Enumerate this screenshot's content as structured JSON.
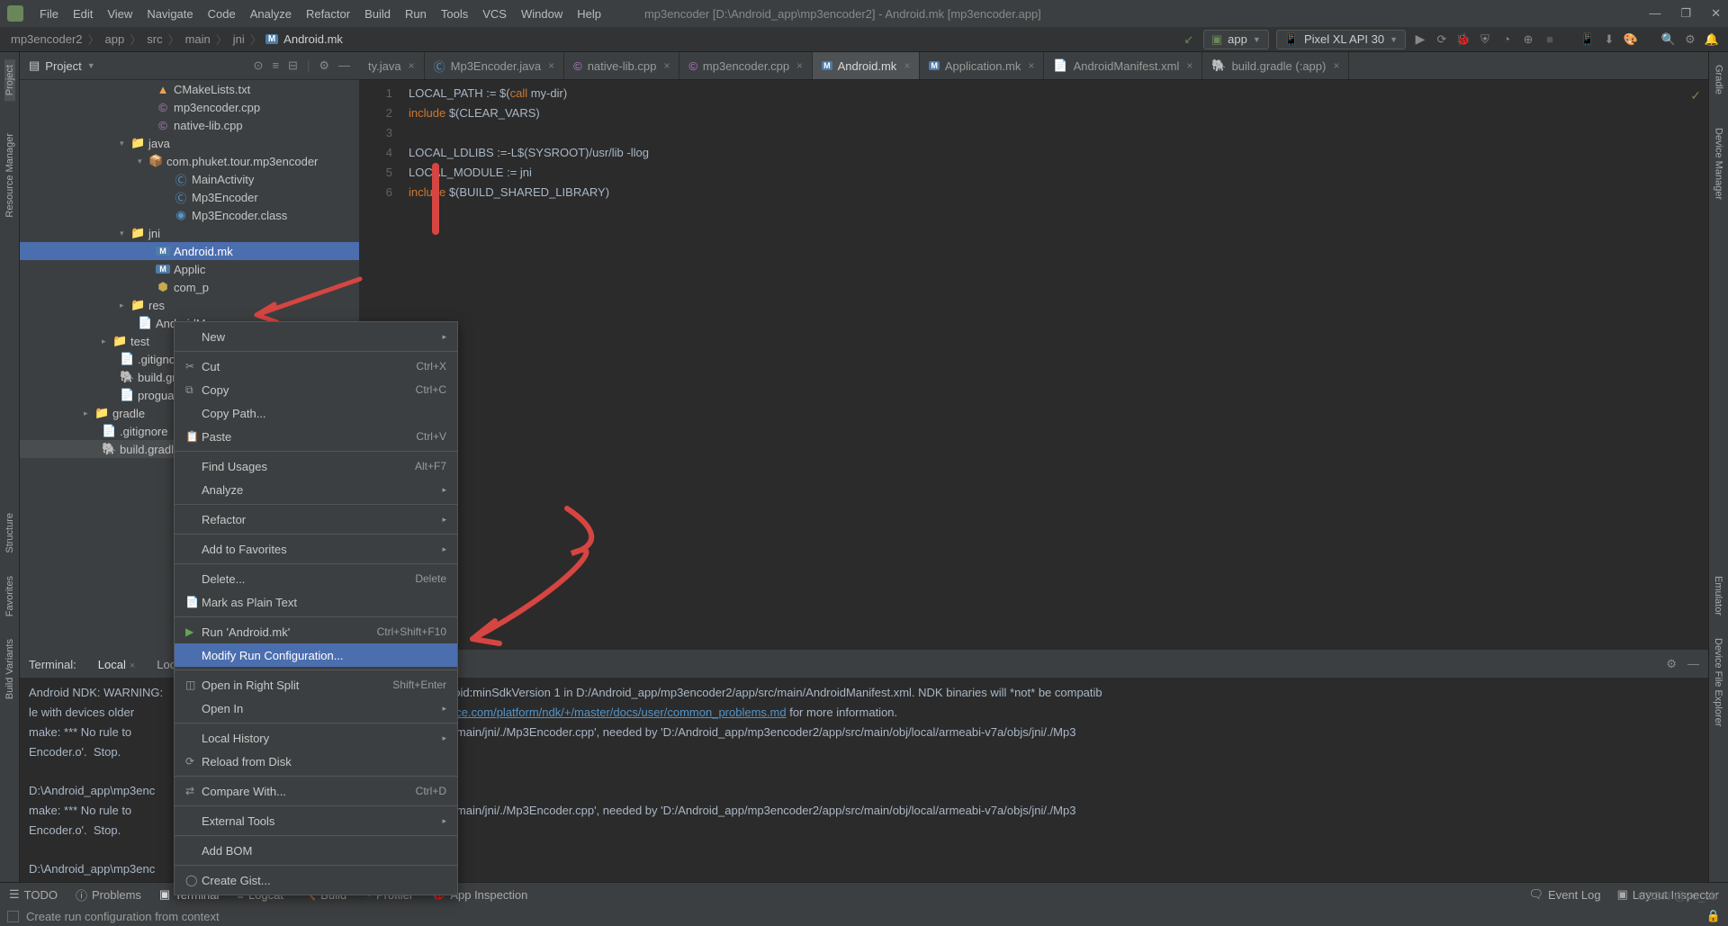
{
  "window": {
    "title": "mp3encoder [D:\\Android_app\\mp3encoder2] - Android.mk [mp3encoder.app]",
    "minimize": "—",
    "maximize": "❐",
    "close": "✕"
  },
  "menu": {
    "file": "File",
    "edit": "Edit",
    "view": "View",
    "navigate": "Navigate",
    "code": "Code",
    "analyze": "Analyze",
    "refactor": "Refactor",
    "build": "Build",
    "run": "Run",
    "tools": "Tools",
    "vcs": "VCS",
    "window": "Window",
    "help": "Help"
  },
  "breadcrumb": {
    "c0": "mp3encoder2",
    "c1": "app",
    "c2": "src",
    "c3": "main",
    "c4": "jni",
    "c5": "Android.mk"
  },
  "toolbar": {
    "config": "app",
    "device": "Pixel XL API 30"
  },
  "leftrail": {
    "project": "Project",
    "resmgr": "Resource Manager",
    "structure": "Structure",
    "favorites": "Favorites",
    "buildvariants": "Build Variants"
  },
  "rightrail": {
    "gradle": "Gradle",
    "devmgr": "Device Manager",
    "emulator": "Emulator",
    "devexp": "Device File Explorer"
  },
  "projpanel": {
    "title": "Project"
  },
  "tree": {
    "cmake": "CMakeLists.txt",
    "mp3cpp": "mp3encoder.cpp",
    "native": "native-lib.cpp",
    "java": "java",
    "pkg": "com.phuket.tour.mp3encoder",
    "mainact": "MainActivity",
    "mp3enc": "Mp3Encoder",
    "mp3cls": "Mp3Encoder.class",
    "jni": "jni",
    "androidmk": "Android.mk",
    "appmk": "Applic",
    "comp": "com_p",
    "res": "res",
    "manifest": "AndroidM",
    "test": "test",
    "gitignore1": ".gitignore",
    "buildgradle1": "build.gradle",
    "proguard": "proguard-rules.",
    "gradle": "gradle",
    "gitignore2": ".gitignore",
    "buildgradle2": "build.gradle"
  },
  "tabs": {
    "t0": "ty.java",
    "t1": "Mp3Encoder.java",
    "t2": "native-lib.cpp",
    "t3": "mp3encoder.cpp",
    "t4": "Android.mk",
    "t5": "Application.mk",
    "t6": "AndroidManifest.xml",
    "t7": "build.gradle (:app)"
  },
  "code": {
    "l1a": "LOCAL_PATH := $(",
    "l1b": "call",
    "l1c": " my-dir)",
    "l2a": "include",
    "l2b": " $(CLEAR_VARS)",
    "l3": "",
    "l4": "LOCAL_LDLIBS :=-L$(SYSROOT)/usr/lib -llog",
    "l5": "LOCAL_MODULE := jni",
    "l6a": "include",
    "l6b": " $(BUILD_SHARED_LIBRARY)",
    "ln1": "1",
    "ln2": "2",
    "ln3": "3",
    "ln4": "4",
    "ln5": "5",
    "ln6": "6"
  },
  "ctx": {
    "new": "New",
    "cut": "Cut",
    "copy": "Copy",
    "copypath": "Copy Path...",
    "paste": "Paste",
    "findusages": "Find Usages",
    "analyze": "Analyze",
    "refactor": "Refactor",
    "addfav": "Add to Favorites",
    "delete": "Delete...",
    "markplain": "Mark as Plain Text",
    "runandroid": "Run 'Android.mk'",
    "modifyrun": "Modify Run Configuration...",
    "opensplit": "Open in Right Split",
    "openin": "Open In",
    "localhist": "Local History",
    "reload": "Reload from Disk",
    "compare": "Compare With...",
    "exttools": "External Tools",
    "addbom": "Add BOM",
    "creategist": "Create Gist...",
    "sc_cut": "Ctrl+X",
    "sc_copy": "Ctrl+C",
    "sc_paste": "Ctrl+V",
    "sc_find": "Alt+F7",
    "sc_delete": "Delete",
    "sc_run": "Ctrl+Shift+F10",
    "sc_split": "Shift+Enter",
    "sc_compare": "Ctrl+D"
  },
  "termpanel": {
    "label": "Terminal:",
    "local": "Local",
    "local2": "Loca"
  },
  "terminal": {
    "l1a": "Android NDK: WARNING:",
    "l1b": "r than android:minSdkVersion 1 in D:/Android_app/mp3encoder2/app/src/main/AndroidManifest.xml. NDK binaries will *not* be compatib",
    "l2a": "le with devices older",
    "l2link": "droid.googlesource.com/platform/ndk/+/master/docs/user/common_problems.md",
    "l2b": " for more information.",
    "l3a": "make: *** No rule to ",
    "l3b": "ncoder2/app/src/main/jni/./Mp3Encoder.cpp', needed by 'D:/Android_app/mp3encoder2/app/src/main/obj/local/armeabi-v7a/objs/jni/./Mp3",
    "l4": "Encoder.o'.  Stop.",
    "l5": "",
    "l6": "D:\\Android_app\\mp3enc",
    "l7a": "make: *** No rule to ",
    "l7b": "ncoder2/app/src/main/jni/./Mp3Encoder.cpp', needed by 'D:/Android_app/mp3encoder2/app/src/main/obj/local/armeabi-v7a/objs/jni/./Mp3",
    "l8": "Encoder.o'.  Stop.",
    "l9": "",
    "l10": "D:\\Android_app\\mp3enc"
  },
  "bottomtb": {
    "todo": "TODO",
    "problems": "Problems",
    "terminal": "Terminal",
    "logcat": "Logcat",
    "build": "Build",
    "profiler": "Profiler",
    "appinsp": "App Inspection",
    "eventlog": "Event Log",
    "layoutinsp": "Layout Inspector"
  },
  "status": {
    "text": "Create run configuration from context",
    "watermark": "CSDN @yu_sb"
  }
}
